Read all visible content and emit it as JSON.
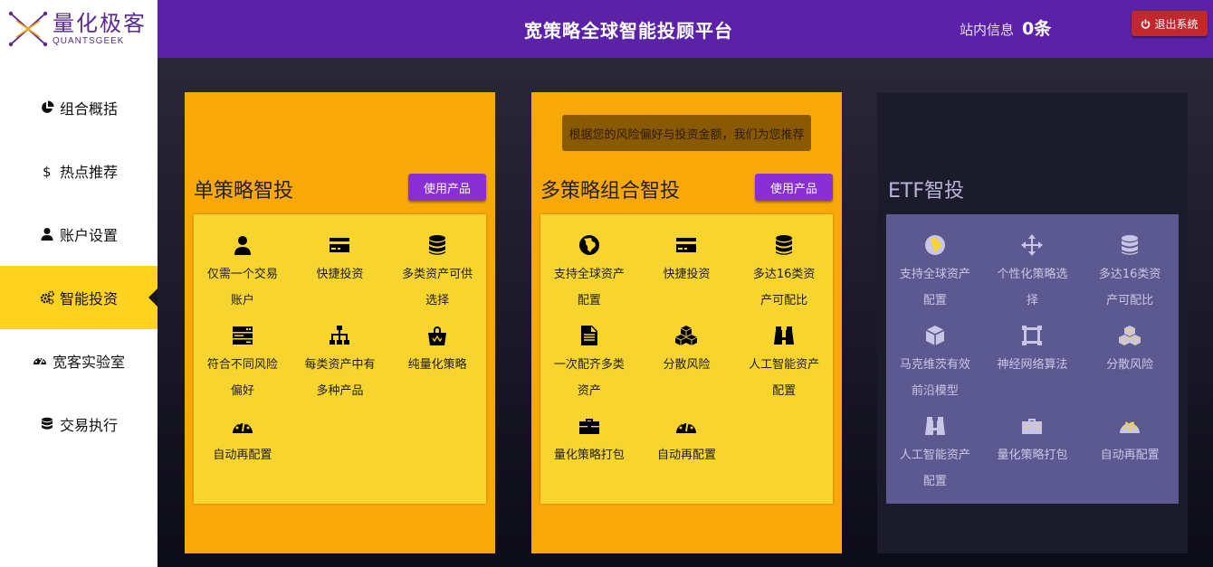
{
  "logo": {
    "cn": "量化极客",
    "en": "QUANTSGEEK"
  },
  "sidebar": {
    "items": [
      {
        "label": "组合概括",
        "icon": "pie-chart-icon"
      },
      {
        "label": "热点推荐",
        "icon": "dollar-icon"
      },
      {
        "label": "账户设置",
        "icon": "user-icon"
      },
      {
        "label": "智能投资",
        "icon": "gears-icon",
        "active": true
      },
      {
        "label": "宽客实验室",
        "icon": "dashboard-icon"
      },
      {
        "label": "交易执行",
        "icon": "database-icon"
      }
    ]
  },
  "header": {
    "title": "宽策略全球智能投顾平台",
    "msg_label": "站内信息",
    "msg_count": "0条",
    "logout_label": "退出系统"
  },
  "cards": [
    {
      "title": "单策略智投",
      "button": "使用产品",
      "features": [
        {
          "icon": "user-icon",
          "label": "仅需一个交易账户"
        },
        {
          "icon": "credit-card-icon",
          "label": "快捷投资"
        },
        {
          "icon": "database-icon",
          "label": "多类资产可供选择"
        },
        {
          "icon": "server-icon",
          "label": "符合不同风险偏好"
        },
        {
          "icon": "sitemap-icon",
          "label": "每类资产中有多种产品"
        },
        {
          "icon": "shopping-bag-icon",
          "label": "纯量化策略"
        },
        {
          "icon": "dashboard-icon",
          "label": "自动再配置"
        }
      ]
    },
    {
      "title": "多策略组合智投",
      "button": "使用产品",
      "tooltip": "根据您的风险偏好与投资金额，我们为您推荐",
      "features": [
        {
          "icon": "globe-icon",
          "label": "支持全球资产配置"
        },
        {
          "icon": "credit-card-icon",
          "label": "快捷投资"
        },
        {
          "icon": "database-icon",
          "label": "多达16类资产可配比"
        },
        {
          "icon": "file-icon",
          "label": "一次配齐多类资产"
        },
        {
          "icon": "cubes-icon",
          "label": "分散风险"
        },
        {
          "icon": "binoculars-icon",
          "label": "人工智能资产配置"
        },
        {
          "icon": "briefcase-icon",
          "label": "量化策略打包"
        },
        {
          "icon": "dashboard-icon",
          "label": "自动再配置"
        }
      ]
    },
    {
      "title": "ETF智投",
      "features": [
        {
          "icon": "globe-icon",
          "label": "支持全球资产配置"
        },
        {
          "icon": "arrows-icon",
          "label": "个性化策略选择"
        },
        {
          "icon": "database-icon",
          "label": "多达16类资产可配比"
        },
        {
          "icon": "cube-icon",
          "label": "马克维茨有效前沿模型"
        },
        {
          "icon": "vector-icon",
          "label": "神经网络算法"
        },
        {
          "icon": "cubes-icon",
          "label": "分散风险"
        },
        {
          "icon": "binoculars-icon",
          "label": "人工智能资产配置"
        },
        {
          "icon": "briefcase-icon",
          "label": "量化策略打包"
        },
        {
          "icon": "dashboard-icon",
          "label": "自动再配置"
        }
      ]
    }
  ],
  "colors": {
    "header": "#5b22a8",
    "active_nav": "#ffd21f",
    "card_orange": "#f9a80a",
    "feature_yellow": "#f8d42e",
    "etf_box": "#5c5990",
    "button_purple": "#8a2fd6",
    "logout_red": "#c0282d"
  }
}
